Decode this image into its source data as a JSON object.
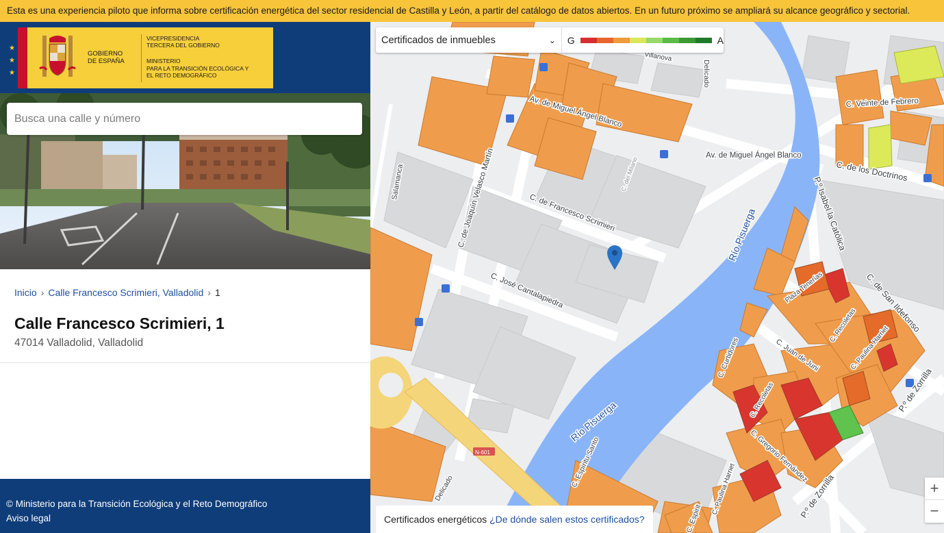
{
  "banner": {
    "text": "Esta es una experiencia piloto que informa sobre certificación energética del sector residencial de Castilla y León, a partir del catálogo de datos abiertos. En un futuro próximo se ampliará su alcance geográfico y sectorial."
  },
  "logo": {
    "gov_line1": "GOBIERNO",
    "gov_line2": "DE ESPAÑA",
    "vice_line1": "VICEPRESIDENCIA",
    "vice_line2": "TERCERA DEL GOBIERNO",
    "min_line1": "MINISTERIO",
    "min_line2": "PARA LA TRANSICIÓN ECOLÓGICA Y",
    "min_line3": "EL RETO DEMOGRÁFICO"
  },
  "search": {
    "placeholder": "Busca una calle y número"
  },
  "breadcrumb": [
    {
      "label": "Inicio"
    },
    {
      "label": "Calle Francesco Scrimieri, Valladolid"
    },
    {
      "label": "1"
    }
  ],
  "address": {
    "title": "Calle Francesco Scrimieri, 1",
    "subtitle": "47014 Valladolid, Valladolid"
  },
  "footer": {
    "copyright": "© Ministerio para la Transición Ecológica y el Reto Demográfico",
    "legal_link": "Aviso legal"
  },
  "map_controls": {
    "layer_select": "Certificados de inmuebles",
    "scale_low": "G",
    "scale_high": "A",
    "scale_colors": [
      "#d62f2f",
      "#e8662b",
      "#ef9a3c",
      "#d9e85a",
      "#96d96a",
      "#5bbb46",
      "#3c9a32",
      "#217a2b"
    ],
    "zoom_in": "+",
    "zoom_out": "−",
    "cert_footer_label": "Certificados energéticos",
    "cert_footer_link": "¿De dónde salen estos certificados?"
  },
  "map_labels": {
    "street_1": "Av. de Miguel Ángel Blanco",
    "street_2": "Av. de Miguel Ángel Blanco",
    "street_3": "C. Veinte de Febrero",
    "street_4": "C. de los Doctrinos",
    "street_5": "C. de Joaquín Velasco Martín",
    "street_6": "C. de Francesco Scrimieri",
    "street_7": "C. José Cantalapiedra",
    "street_8": "Río Pisuerga",
    "street_9": "Río Pisuerga",
    "street_10": "P.º Isabel la Católica",
    "street_11": "C. de San Ildefonso",
    "street_12": "Plaza Tenerías",
    "street_13": "C. Recoletas",
    "street_14": "C. Juan de Juni",
    "street_15": "C. Curtidores",
    "street_16": "C. Paulina Harriet",
    "street_17": "C. Recoletas",
    "street_18": "C. Gregorio Fernández",
    "street_19": "P.º de Zorrilla",
    "street_20": "P.º de Zorrilla",
    "street_21": "C. Paulina Harriet",
    "street_22": "C. Espíritu Santo",
    "street_23": "Delicado",
    "street_24": "Salamanca",
    "street_25": "N-601",
    "street_26": "Villanova",
    "street_27": "C. del Milano",
    "street_28": "Delicado",
    "street_29": "C. Espirit"
  }
}
